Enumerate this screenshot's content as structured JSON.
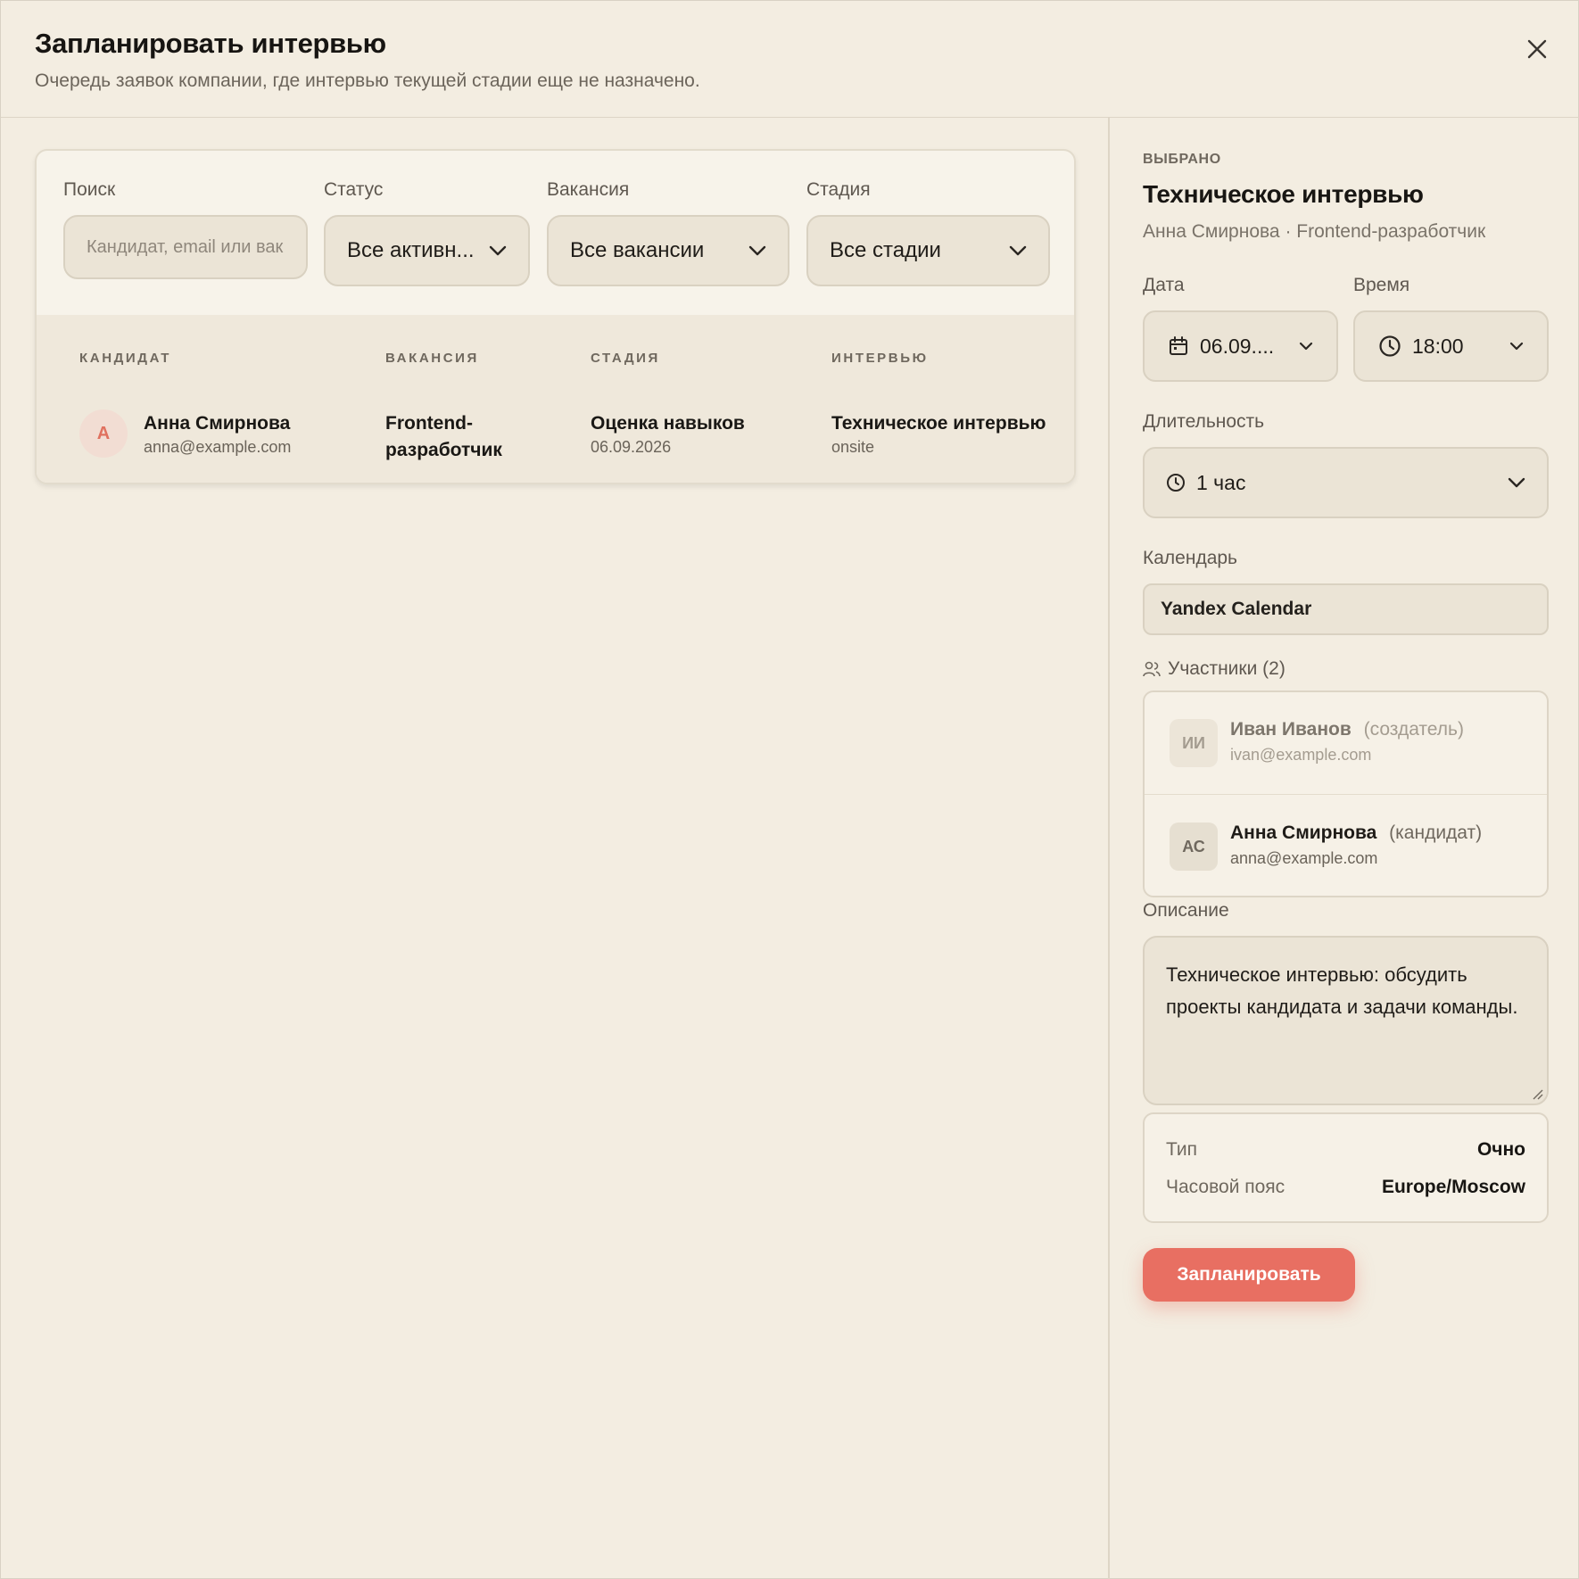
{
  "dialog": {
    "title": "Запланировать интервью",
    "subtitle": "Очередь заявок компании, где интервью текущей стадии еще не назначено."
  },
  "filters": {
    "search_label": "Поиск",
    "search_placeholder": "Кандидат, email или вак",
    "status_label": "Статус",
    "status_value": "Все активн...",
    "vacancy_label": "Вакансия",
    "vacancy_value": "Все вакансии",
    "stage_label": "Стадия",
    "stage_value": "Все стадии"
  },
  "table": {
    "headers": [
      "КАНДИДАТ",
      "ВАКАНСИЯ",
      "СТАДИЯ",
      "ИНТЕРВЬЮ"
    ],
    "rows": [
      {
        "avatar": "A",
        "candidate_name": "Анна Смирнова",
        "candidate_email": "anna@example.com",
        "vacancy": "Frontend-разработчик",
        "stage": "Оценка навыков",
        "stage_date": "06.09.2026",
        "interview": "Техническое интервью",
        "interview_format": "onsite"
      }
    ]
  },
  "selected": {
    "eyebrow": "ВЫБРАНО",
    "title": "Техническое интервью",
    "subtitle": "Анна Смирнова · Frontend-разработчик",
    "date_label": "Дата",
    "date_value": "06.09....",
    "time_label": "Время",
    "time_value": "18:00",
    "duration_label": "Длительность",
    "duration_value": "1 час",
    "calendar_label": "Календарь",
    "calendar_value": "Yandex Calendar",
    "participants_label": "Участники (2)",
    "participants": [
      {
        "initials": "ИИ",
        "name": "Иван Иванов",
        "role": "(создатель)",
        "email": "ivan@example.com"
      },
      {
        "initials": "АС",
        "name": "Анна Смирнова",
        "role": "(кандидат)",
        "email": "anna@example.com"
      }
    ],
    "description_label": "Описание",
    "description": "Техническое интервью: обсудить проекты кандидата и задачи команды.",
    "type_label": "Тип",
    "type_value": "Очно",
    "timezone_label": "Часовой пояс",
    "timezone_value": "Europe/Moscow",
    "submit_label": "Запланировать"
  },
  "colors": {
    "accent": "#e86f62",
    "background": "#f3ede1",
    "field": "#ebe4d6"
  },
  "icons": [
    "close-icon",
    "chevron-down-icon",
    "calendar-icon",
    "clock-icon",
    "users-icon",
    "resize-handle-icon"
  ]
}
